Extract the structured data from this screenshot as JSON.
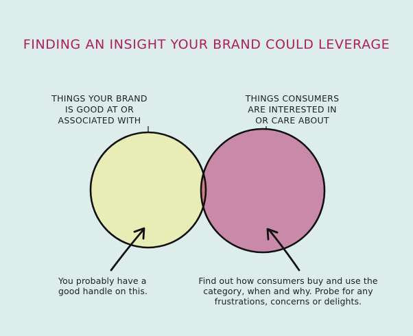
{
  "title": "FINDING AN INSIGHT YOUR BRAND COULD LEVERAGE",
  "left_circle": {
    "label_lines": [
      "THINGS YOUR BRAND",
      "IS GOOD AT OR",
      "ASSOCIATED WITH"
    ],
    "fill": "#e8edb6",
    "note_lines": [
      "You probably have a",
      "good handle on this."
    ]
  },
  "right_circle": {
    "label_lines": [
      "THINGS CONSUMERS",
      "ARE INTERESTED IN",
      "OR CARE ABOUT"
    ],
    "fill": "#c98aa9",
    "note_lines": [
      "Find out how consumers buy and use the",
      "category, when and why. Probe for any",
      "frustrations, concerns or delights."
    ]
  },
  "overlap_fill": "#cc8083",
  "colors": {
    "background": "#dcedec",
    "title": "#b01d5b",
    "outline": "#111111"
  }
}
